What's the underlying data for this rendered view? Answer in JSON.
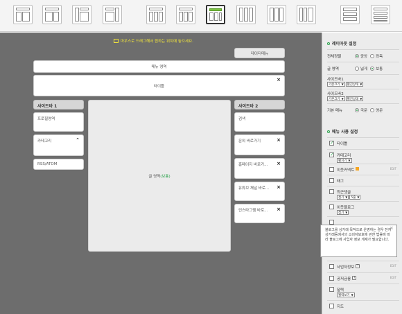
{
  "toolbar": {
    "layouts": [
      "layout-1",
      "layout-2",
      "layout-3",
      "layout-4",
      "layout-5",
      "layout-6",
      "layout-7",
      "layout-8",
      "layout-9",
      "layout-10",
      "layout-11",
      "layout-12"
    ],
    "active_index": 6,
    "accent_color": "#7cc242"
  },
  "canvas": {
    "hint": "마우스로 드래그해서 원하는 위치에 놓으세요.",
    "menu_toggle": "데이터메뉴",
    "menu_area": "메뉴 영역",
    "title": "타이틀",
    "content": "글 영역",
    "content_suffix": "(보통)",
    "sidebar1": {
      "header": "사이드바 1",
      "widgets": [
        "프로필영역",
        "카테고리",
        "RSS/ATOM"
      ]
    },
    "sidebar2": {
      "header": "사이드바 2",
      "widgets": [
        "검색",
        "문의 바로가기",
        "홈페이지 바로가...",
        "유튜브 채널 바로...",
        "인스타그램 바로..."
      ]
    }
  },
  "panel": {
    "layout_settings": {
      "title": "레이아웃 설정",
      "width_label": "전체정렬",
      "width_options": [
        "중앙",
        "좌측"
      ],
      "content_label": "글 영역",
      "content_options": [
        "넓게",
        "보통"
      ],
      "sidebar1_label": "사이드바1",
      "sidebar1_sel": [
        "기본크기",
        "펼친상태"
      ],
      "sidebar2_label": "사이드바2",
      "sidebar2_sel": [
        "기본크기",
        "펼친상태"
      ],
      "menu_label": "기본 메뉴",
      "menu_options": [
        "국문",
        "영문"
      ]
    },
    "menu_settings": {
      "title": "메뉴 사용 설정",
      "items": {
        "title": "타이틀",
        "category": "카테고리",
        "category_sel": "펼치기",
        "event": "이웃커넥트",
        "event_edit": "EDIT",
        "tag": "태그",
        "recent": "최근댓글",
        "recent_sel_a": "접기",
        "recent_sel_b": "5줄",
        "neighbor": "이웃블로그",
        "neighbor_sel": "접기",
        "biz": "사업자정보",
        "biz_edit": "EDIT",
        "public": "공저금융",
        "public_edit": "EDIT",
        "calendar": "달력",
        "calendar_sel": "월력보기",
        "map": "지도"
      }
    },
    "tooltip": {
      "text": "블로그를 상거래 목적으로 운영하는 경우 전자상거래등에서의 소비자보호에 관한 법률에 따라 블로그에 사업자 정보 게재가 필요합니다."
    }
  }
}
